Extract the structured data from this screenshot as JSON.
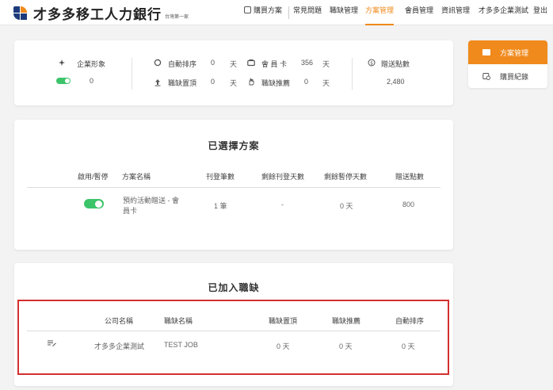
{
  "header": {
    "brand": "才多多移工人力銀行",
    "tagline": "台灣第一家",
    "nav": {
      "buy_plan": "購買方案",
      "faq": "常見問題",
      "job_manage": "職缺管理",
      "plan_manage": "方案管理",
      "member_manage": "會員管理",
      "profile_manage": "資訊管理",
      "user": "才多多企業測試",
      "logout": "登出"
    },
    "active_nav": "plan_manage",
    "accent_color": "#f08a1c"
  },
  "stats": {
    "brand_image": {
      "label": "企業形象",
      "enabled": true,
      "value": "0"
    },
    "auto_sort": {
      "label": "自動排序",
      "value": "0",
      "unit": "天"
    },
    "job_top": {
      "label": "職缺置頂",
      "value": "0",
      "unit": "天"
    },
    "member_card": {
      "label": "會 員 卡",
      "value": "356",
      "unit": "天"
    },
    "job_recommend": {
      "label": "職缺推薦",
      "value": "0",
      "unit": "天"
    },
    "bonus_points": {
      "label": "贈送點數",
      "value": "2,480"
    }
  },
  "selected_plans": {
    "title": "已選擇方案",
    "columns": [
      "啟用/暫停",
      "方案名稱",
      "刊登筆數",
      "剩餘刊登天數",
      "剩餘暫停天數",
      "贈送點數"
    ],
    "rows": [
      {
        "enabled": true,
        "name_line1": "預約活動贈送 - 會",
        "name_line2": "員卡",
        "count": "1 筆",
        "remaining_days": "-",
        "pause_days": "0 天",
        "points": "800"
      }
    ]
  },
  "added_jobs": {
    "title": "已加入職缺",
    "columns": [
      "公司名稱",
      "職缺名稱",
      "職缺置頂",
      "職缺推薦",
      "自動排序"
    ],
    "rows": [
      {
        "company": "才多多企業測試",
        "job": "TEST JOB",
        "top": "0 天",
        "recommend": "0 天",
        "auto_sort": "0 天"
      }
    ]
  },
  "side_menu": {
    "plan_manage": "方案管理",
    "purchase_history": "購買紀錄"
  },
  "icons": [
    "sparkle-icon",
    "refresh-icon",
    "upload-icon",
    "wallet-icon",
    "hand-icon",
    "coin-icon",
    "card-icon",
    "history-icon",
    "edit-list-icon",
    "cart-icon"
  ]
}
